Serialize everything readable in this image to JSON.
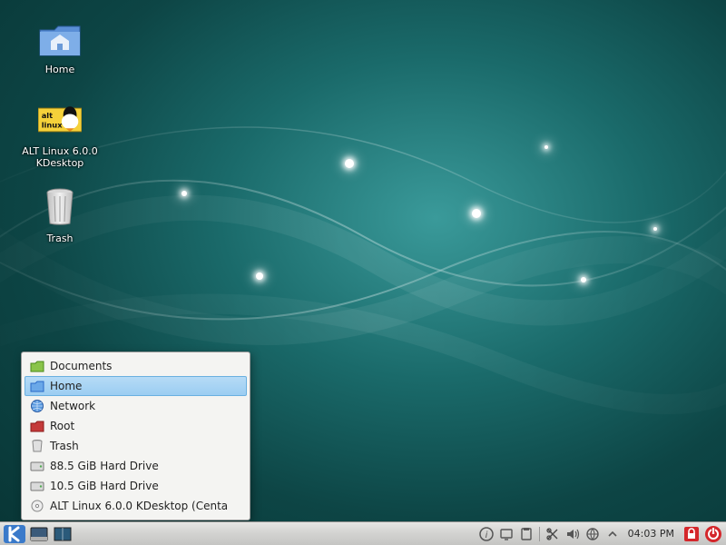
{
  "desktop": {
    "icons": {
      "home": "Home",
      "altlinux": "ALT Linux 6.0.0 KDesktop",
      "trash": "Trash"
    }
  },
  "places_menu": {
    "items": [
      {
        "id": "documents",
        "label": "Documents",
        "icon": "folder-green",
        "selected": false
      },
      {
        "id": "home",
        "label": "Home",
        "icon": "folder-blue",
        "selected": true
      },
      {
        "id": "network",
        "label": "Network",
        "icon": "globe",
        "selected": false
      },
      {
        "id": "root",
        "label": "Root",
        "icon": "folder-red",
        "selected": false
      },
      {
        "id": "trash",
        "label": "Trash",
        "icon": "trash",
        "selected": false
      },
      {
        "id": "hdd1",
        "label": "88.5 GiB Hard Drive",
        "icon": "hdd",
        "selected": false
      },
      {
        "id": "hdd2",
        "label": "10.5 GiB Hard Drive",
        "icon": "hdd",
        "selected": false
      },
      {
        "id": "cd",
        "label": "ALT Linux 6.0.0 KDesktop  (Centa",
        "icon": "cd",
        "selected": false
      }
    ]
  },
  "taskbar": {
    "clock": "04:03 PM"
  },
  "colors": {
    "accent_teal": "#1a6a6a",
    "selection_blue": "#9bcdf2",
    "power_red": "#d4272b",
    "lock_red": "#d4272b"
  }
}
